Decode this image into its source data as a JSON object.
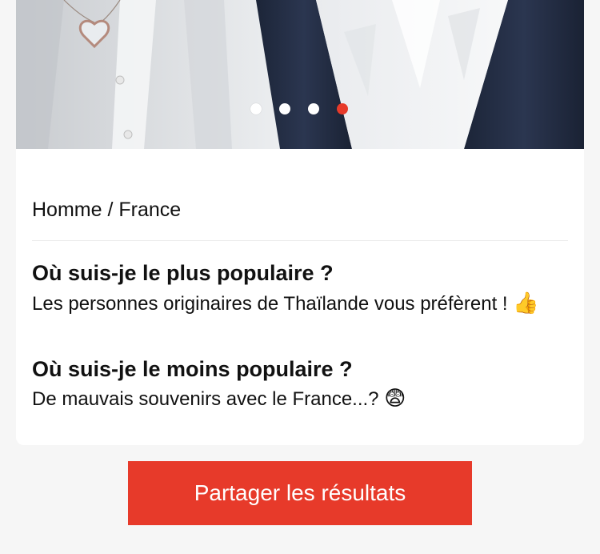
{
  "carousel": {
    "slide_count": 4,
    "active_index": 3,
    "dot_color": "#ffffff",
    "active_dot_color": "#e73a2a"
  },
  "profile": {
    "breadcrumb": "Homme / France"
  },
  "questions": [
    {
      "title": "Où suis-je le plus populaire ?",
      "answer": "Les personnes originaires de Thaïlande vous préfèrent !",
      "emoji": "👍",
      "emoji_name": "thumbs-up-icon"
    },
    {
      "title": "Où suis-je le moins populaire ?",
      "answer": "De mauvais souvenirs avec le France...?",
      "emoji": "😨",
      "emoji_name": "fearful-face-icon"
    }
  ],
  "actions": {
    "share_label": "Partager les résultats",
    "accent_color": "#e73a2a"
  }
}
